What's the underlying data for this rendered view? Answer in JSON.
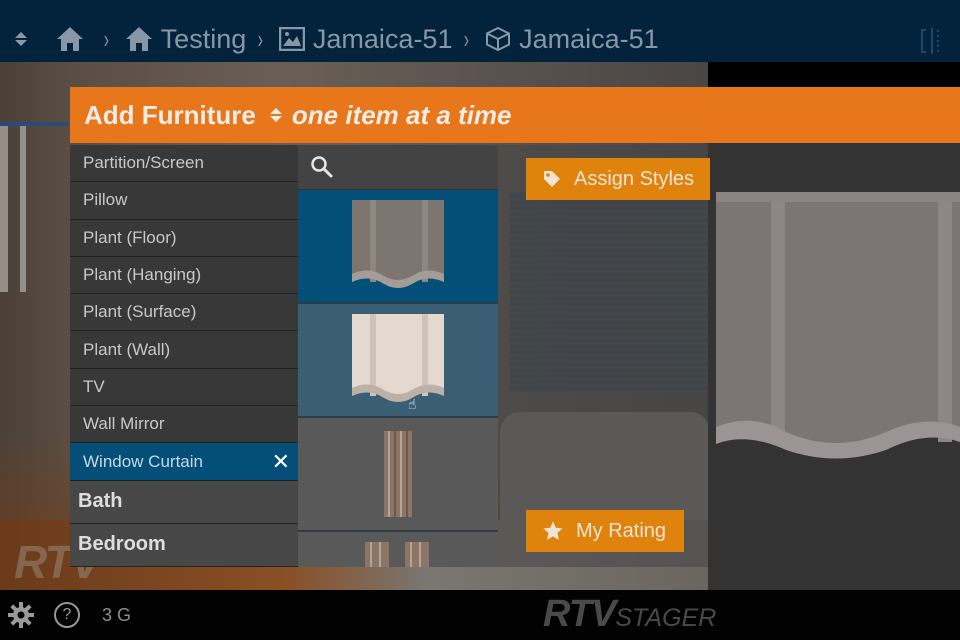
{
  "topbar": {
    "breadcrumbs": [
      {
        "label": "",
        "icon": "home-icon"
      },
      {
        "label": "Testing",
        "icon": "home-icon"
      },
      {
        "label": "Jamaica-51",
        "icon": "image-icon"
      },
      {
        "label": "Jamaica-51",
        "icon": "cube-icon"
      }
    ],
    "separator": "›",
    "right_icon": "split-view-icon"
  },
  "panel": {
    "title": "Add Furniture",
    "sort_icon": "sort-icon",
    "mode": "one item at a time",
    "accent_color": "#e8761b"
  },
  "categories": {
    "items": [
      {
        "label": "Partition/Screen",
        "selected": false
      },
      {
        "label": "Pillow",
        "selected": false
      },
      {
        "label": "Plant (Floor)",
        "selected": false
      },
      {
        "label": "Plant (Hanging)",
        "selected": false
      },
      {
        "label": "Plant (Surface)",
        "selected": false
      },
      {
        "label": "Plant (Wall)",
        "selected": false
      },
      {
        "label": "TV",
        "selected": false
      },
      {
        "label": "Wall Mirror",
        "selected": false
      },
      {
        "label": "Window Curtain",
        "selected": true
      }
    ],
    "clear_label": "✕",
    "groups": [
      {
        "label": "Bath"
      },
      {
        "label": "Bedroom"
      }
    ],
    "selected_color": "#034f77"
  },
  "items_panel": {
    "search_placeholder": "",
    "thumbnails": [
      {
        "name": "gray-roman-curtain",
        "state": "selected"
      },
      {
        "name": "cream-roman-curtain",
        "state": "hovered"
      },
      {
        "name": "brown-drape-curtain",
        "state": "normal"
      },
      {
        "name": "brown-drape-pair-curtain",
        "state": "normal"
      }
    ]
  },
  "actions": {
    "assign_styles": "Assign Styles",
    "my_rating": "My Rating",
    "button_color": "#df830c"
  },
  "bottombar": {
    "count_text": "3 G",
    "brand_main": "RTV",
    "brand_sub": "STAGER"
  },
  "watermark": "RTV"
}
